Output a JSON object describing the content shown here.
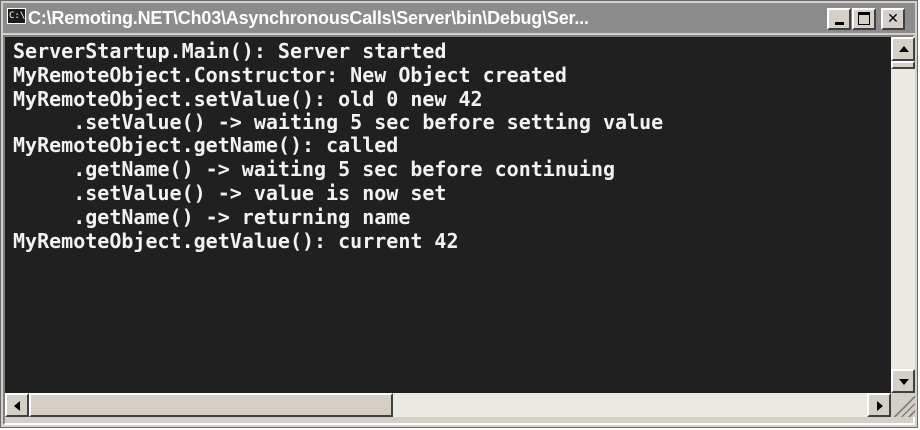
{
  "window": {
    "title": "C:\\Remoting.NET\\Ch03\\AsynchronousCalls\\Server\\bin\\Debug\\Ser...",
    "icon_text": "C:\\",
    "icon": "console-icon",
    "controls": [
      "minimize-icon",
      "maximize-icon",
      "close-icon"
    ]
  },
  "console": {
    "lines": [
      "ServerStartup.Main(): Server started",
      "MyRemoteObject.Constructor: New Object created",
      "MyRemoteObject.setValue(): old 0 new 42",
      "     .setValue() -> waiting 5 sec before setting value",
      "MyRemoteObject.getName(): called",
      "     .getName() -> waiting 5 sec before continuing",
      "     .setValue() -> value is now set",
      "     .getName() -> returning name",
      "MyRemoteObject.getValue(): current 42"
    ],
    "background": "#202020",
    "foreground": "#f2f2f2"
  },
  "scrollbars": {
    "vertical_icons": [
      "scroll-up-icon",
      "scroll-down-icon"
    ],
    "horizontal_icons": [
      "scroll-left-icon",
      "scroll-right-icon"
    ]
  }
}
